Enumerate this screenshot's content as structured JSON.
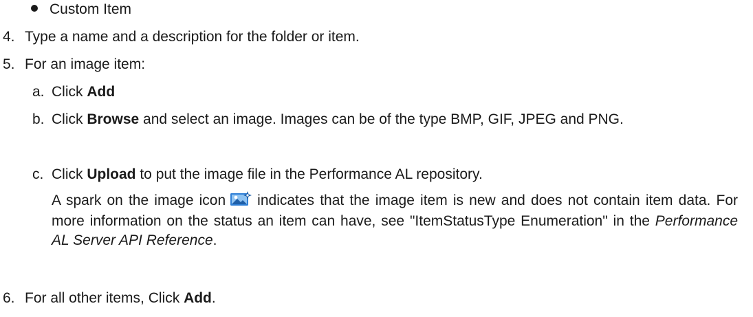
{
  "bullet_item": "Custom Item",
  "steps": {
    "s4": {
      "num": "4.",
      "text": "Type a name and a description for the folder or item."
    },
    "s5": {
      "num": "5.",
      "text": "For an image item:",
      "a": {
        "letter": "a.",
        "pre": "Click ",
        "bold": "Add"
      },
      "b": {
        "letter": "b.",
        "pre": "Click ",
        "bold": "Browse",
        "post": " and select an image. Images can be of the type BMP, GIF, JPEG and PNG."
      },
      "c": {
        "letter": "c.",
        "pre": "Click ",
        "bold": "Upload",
        "post": " to put the image file in the Performance AL repository."
      },
      "note": {
        "pre": "A spark on the image icon",
        "icon": "image-new-spark-icon",
        "mid": "indicates that the image item is new and does not contain item data. For more information on the status an item can have, see \"ItemStatusType Enumeration\" in the ",
        "italic": "Performance AL Server API Reference",
        "post": "."
      }
    },
    "s6": {
      "num": "6.",
      "pre": "For all other items, Click ",
      "bold": "Add",
      "post": "."
    }
  },
  "colors": {
    "text": "#1a1a1a",
    "icon_blue": "#2f7fd6",
    "icon_light": "#8fc3f2"
  }
}
